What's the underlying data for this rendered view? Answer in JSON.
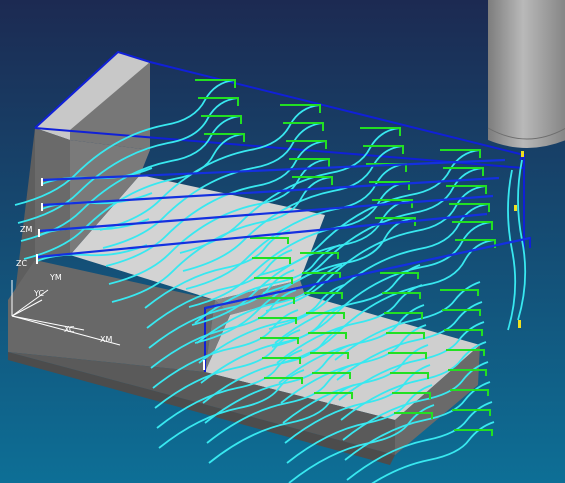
{
  "axes": {
    "zm": "ZM",
    "zc": "ZC",
    "ym": "YM",
    "yc": "YC",
    "xc": "XC",
    "xm": "XM"
  },
  "colors": {
    "background_top": "#1c2a52",
    "background_bottom": "#0d6f96",
    "part_body": "#6f6f6f",
    "part_top": "#d0d0d0",
    "boundary": "#1020d8",
    "toolpath_cut": "#38e8f0",
    "toolpath_engage": "#22e022",
    "toolpath_highlight": "#f0e020",
    "tool": "#9a9a9a"
  },
  "icons": {
    "tool": "end-mill-icon",
    "triad": "coordinate-triad-icon"
  }
}
